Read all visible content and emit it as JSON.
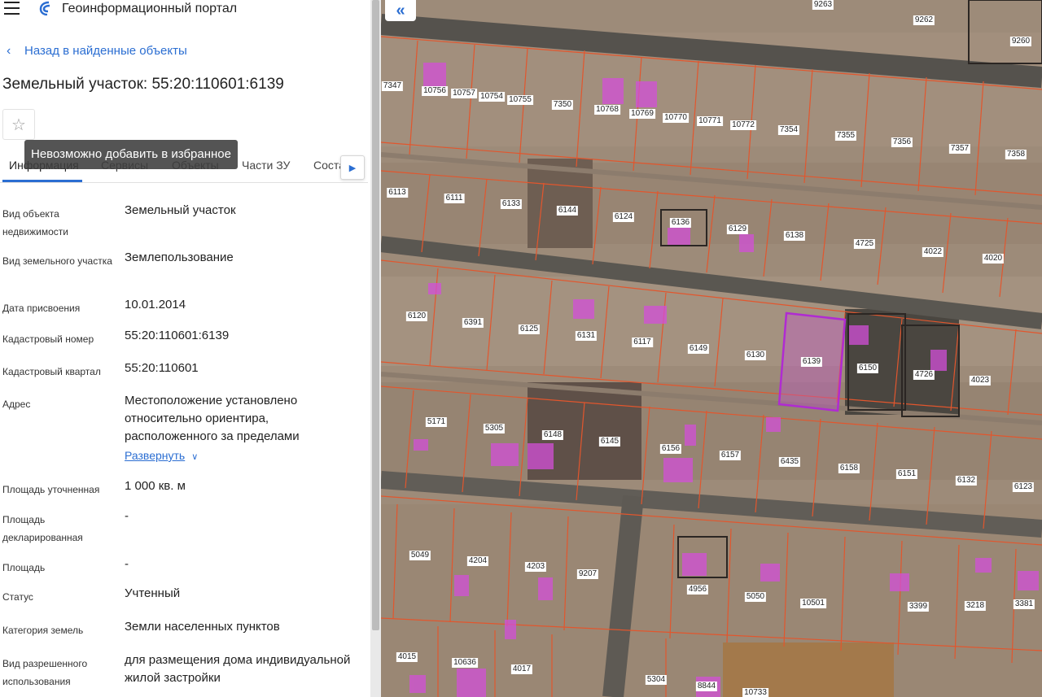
{
  "header": {
    "portal_title": "Геоинформационный портал"
  },
  "back_link": "Назад в найденные объекты",
  "object_title": "Земельный участок: 55:20:110601:6139",
  "tooltip": "Невозможно добавить в избранное",
  "tabs": [
    {
      "label": "Информация",
      "active": true
    },
    {
      "label": "Сервисы"
    },
    {
      "label": "Объекты"
    },
    {
      "label": "Части ЗУ"
    },
    {
      "label": "Соста"
    }
  ],
  "properties": [
    {
      "label": "Вид объекта недвижимости",
      "value": "Земельный участок"
    },
    {
      "label": "Вид земельного участка",
      "value": "Землепользование"
    },
    {
      "label": "Дата присвоения",
      "value": "10.01.2014"
    },
    {
      "label": "Кадастровый номер",
      "value": "55:20:110601:6139"
    },
    {
      "label": "Кадастровый квартал",
      "value": "55:20:110601"
    },
    {
      "label": "Адрес",
      "value": "Местоположение установлено относительно ориентира, расположенного за пределами",
      "expand": "Развернуть"
    },
    {
      "label": "Площадь уточненная",
      "value": "1 000 кв. м"
    },
    {
      "label": "Площадь декларированная",
      "value": "-"
    },
    {
      "label": "Площадь",
      "value": "-"
    },
    {
      "label": "Статус",
      "value": "Учтенный"
    },
    {
      "label": "Категория земель",
      "value": "Земли населенных пунктов"
    },
    {
      "label": "Вид разрешенного использования",
      "value": "для размещения дома индивидуальной жилой застройки"
    }
  ],
  "map": {
    "selected_parcel": "6139",
    "plot_numbers": [
      "9263",
      "9262",
      "9260",
      "7347",
      "10756",
      "10757",
      "10754",
      "10755",
      "7350",
      "10768",
      "10769",
      "10770",
      "10771",
      "10772",
      "7354",
      "7355",
      "7356",
      "7357",
      "7358",
      "6113",
      "6111",
      "6133",
      "6144",
      "6124",
      "6136",
      "6129",
      "6138",
      "4725",
      "4022",
      "4020",
      "6120",
      "6391",
      "6125",
      "6131",
      "6117",
      "6149",
      "6130",
      "6139",
      "6150",
      "4726",
      "4023",
      "5171",
      "5305",
      "6148",
      "6145",
      "6156",
      "6157",
      "6435",
      "6158",
      "6151",
      "6132",
      "6123",
      "5049",
      "4204",
      "4203",
      "9207",
      "4956",
      "5050",
      "10501",
      "3399",
      "3218",
      "3381",
      "4015",
      "10636",
      "4017",
      "5304",
      "8844",
      "10733"
    ]
  }
}
